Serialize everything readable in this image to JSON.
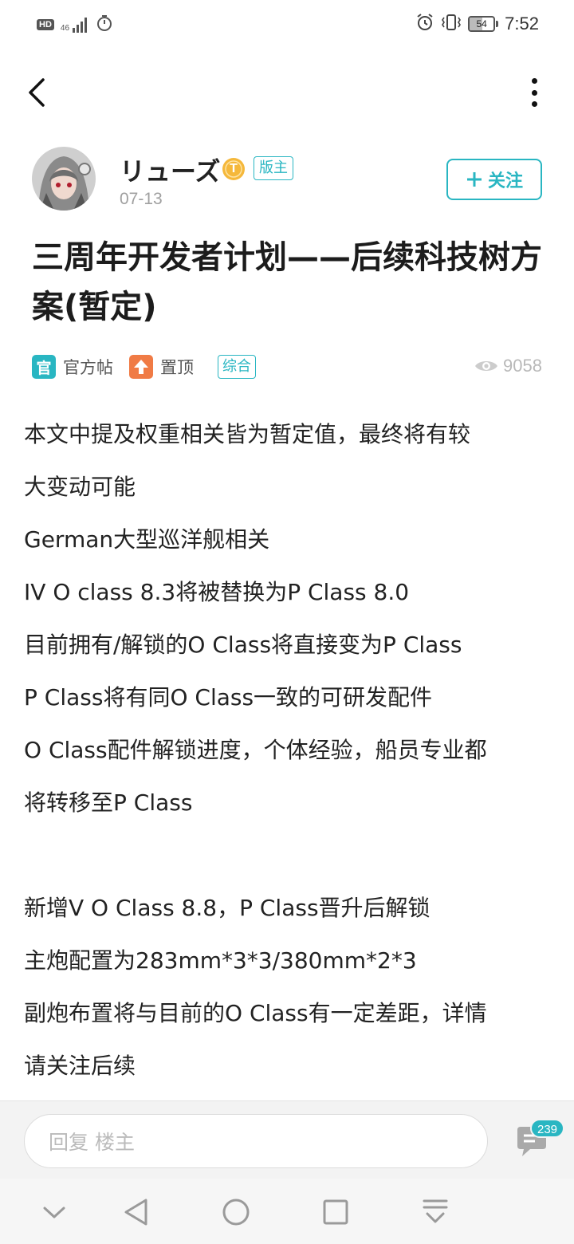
{
  "status_bar": {
    "hd_label": "HD",
    "network_label": "46",
    "time": "7:52",
    "battery": "54",
    "battery_level": 0.54
  },
  "colors": {
    "accent": "#29b6c2",
    "official_tag": "#29b6c2",
    "pin_tag": "#f07b45",
    "level_badge": "#f5b83b"
  },
  "author": {
    "name": "リューズ",
    "level_badge": "T",
    "role_badge": "版主",
    "date": "07-13",
    "follow_label": "关注"
  },
  "post": {
    "title": "三周年开发者计划——后续科技树方案(暂定)",
    "tags": {
      "official_icon": "官",
      "official_label": "官方帖",
      "pinned_label": "置顶",
      "category": "综合"
    },
    "views": "9058",
    "body": [
      "本文中提及权重相关皆为暂定值，最终将有较",
      "大变动可能",
      "German大型巡洋舰相关",
      "IV O class 8.3将被替换为P Class 8.0",
      "目前拥有/解锁的O Class将直接变为P Class",
      "P Class将有同O Class一致的可研发配件",
      "O Class配件解锁进度，个体经验，船员专业都",
      "将转移至P Class",
      "",
      "新增V O Class 8.8，P Class晋升后解锁",
      "主炮配置为283mm*3*3/380mm*2*3",
      "副炮布置将与目前的O Class有一定差距，详情",
      "请关注后续"
    ]
  },
  "reply_bar": {
    "placeholder": "回复  楼主",
    "comment_count": "239"
  },
  "icons": {
    "back": "back-arrow-icon",
    "more": "more-vertical-icon",
    "eye": "eye-icon",
    "comment": "comment-bubble-icon",
    "pin": "pin-up-arrow-icon"
  }
}
